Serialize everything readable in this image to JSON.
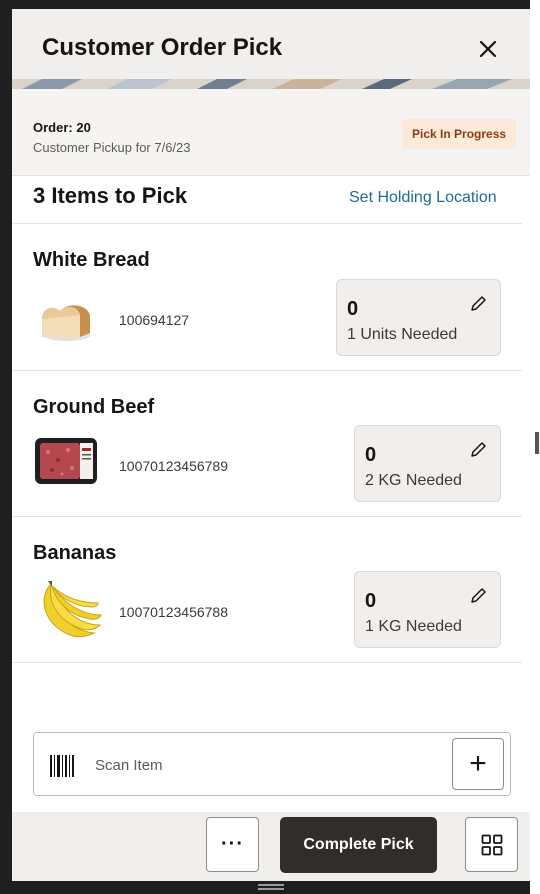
{
  "header": {
    "title": "Customer Order Pick"
  },
  "order": {
    "number": "Order: 20",
    "subtitle": "Customer Pickup for 7/6/23",
    "status": "Pick In Progress"
  },
  "items_section": {
    "heading": "3 Items to Pick",
    "holding_link": "Set Holding Location"
  },
  "items": [
    {
      "name": "White Bread",
      "code": "100694127",
      "qty": "0",
      "needed": "1 Units Needed",
      "icon": "bread-image"
    },
    {
      "name": "Ground Beef",
      "code": "10070123456789",
      "qty": "0",
      "needed": "2 KG Needed",
      "icon": "ground-beef-image"
    },
    {
      "name": "Bananas",
      "code": "10070123456788",
      "qty": "0",
      "needed": "1 KG Needed",
      "icon": "bananas-image"
    }
  ],
  "scan": {
    "label": "Scan Item",
    "add_label": "+"
  },
  "footer": {
    "more_label": "···",
    "complete_label": "Complete Pick"
  },
  "colors": {
    "accent_link": "#1f6a9b",
    "badge_bg": "#fbe9d9",
    "badge_text": "#8a3c10",
    "primary_button": "#312d2a"
  }
}
